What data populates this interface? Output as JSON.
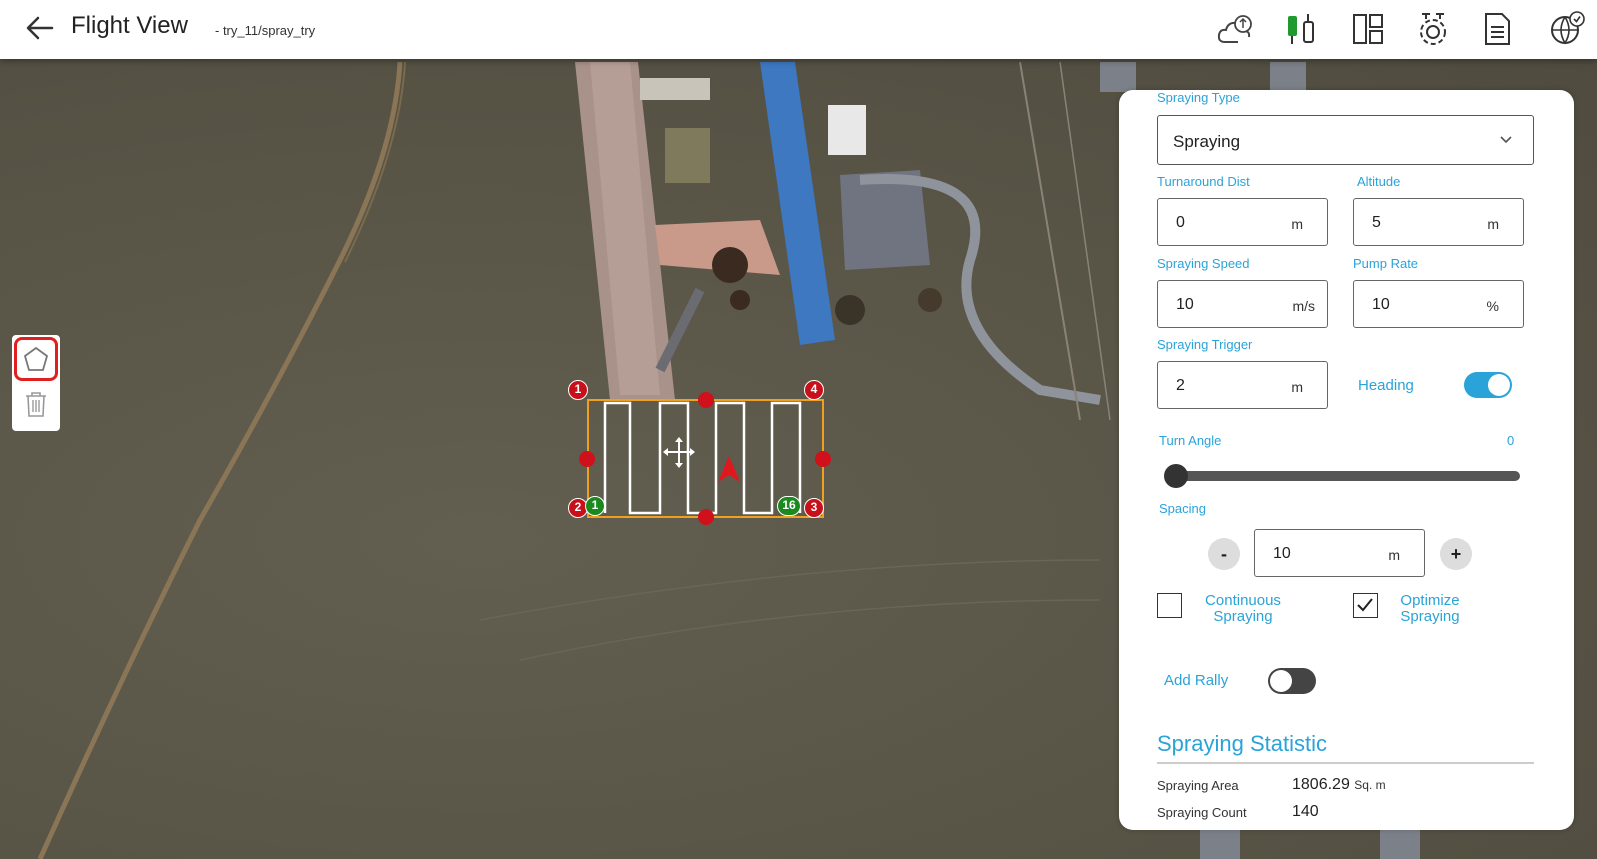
{
  "header": {
    "title": "Flight View",
    "subtitle": "- try_11/spray_try",
    "icons": [
      "back-arrow-icon",
      "cloud-sync-icon",
      "battery-connect-icon",
      "dashboard-layout-icon",
      "drone-settings-icon",
      "document-icon",
      "globe-check-icon"
    ]
  },
  "map": {
    "polygon": {
      "vertices": [
        {
          "label": "1"
        },
        {
          "label": "2"
        },
        {
          "label": "3"
        },
        {
          "label": "4"
        }
      ],
      "waypoint_start": "1",
      "waypoint_end": "16",
      "heading_arrow_color": "#e0181e"
    },
    "tools": [
      "polygon-draw-icon",
      "trash-icon"
    ]
  },
  "panel": {
    "spraying_type": {
      "label": "Spraying Type",
      "value": "Spraying"
    },
    "turnaround_dist": {
      "label": "Turnaround Dist",
      "value": "0",
      "unit": "m"
    },
    "altitude": {
      "label": "Altitude",
      "value": "5",
      "unit": "m"
    },
    "spraying_speed": {
      "label": "Spraying Speed",
      "value": "10",
      "unit": "m/s"
    },
    "pump_rate": {
      "label": "Pump Rate",
      "value": "10",
      "unit": "%"
    },
    "spraying_trigger": {
      "label": "Spraying Trigger",
      "value": "2",
      "unit": "m"
    },
    "heading": {
      "label": "Heading",
      "on": true
    },
    "turn_angle": {
      "label": "Turn Angle",
      "value": "0"
    },
    "spacing": {
      "label": "Spacing",
      "value": "10",
      "unit": "m",
      "minus": "-",
      "plus": "+"
    },
    "continuous_spraying": {
      "label_line1": "Continuous",
      "label_line2": "Spraying",
      "checked": false
    },
    "optimize_spraying": {
      "label_line1": "Optimize",
      "label_line2": "Spraying",
      "checked": true
    },
    "add_rally": {
      "label": "Add Rally",
      "on": false
    },
    "statistic": {
      "title": "Spraying Statistic",
      "area_label": "Spraying Area",
      "area_value": "1806.29",
      "area_unit": "Sq. m",
      "count_label": "Spraying Count",
      "count_value": "140"
    },
    "accent_color": "#2aa3d8"
  }
}
